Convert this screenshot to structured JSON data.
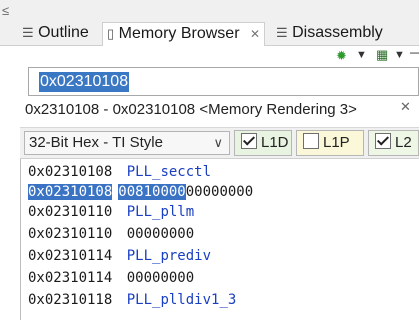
{
  "tabs": [
    {
      "label": "Outline",
      "icon": "outline-icon"
    },
    {
      "label": "Memory Browser",
      "icon": "memory-icon",
      "close": "✕"
    },
    {
      "label": "Disassembly",
      "icon": "disassembly-icon"
    }
  ],
  "address_input": {
    "value": "0x02310108"
  },
  "rendering": {
    "title": "0x2310108 - 0x02310108 <Memory Rendering 3>",
    "close": "✕",
    "format": "32-Bit Hex - TI Style",
    "caches": [
      {
        "label": "L1D",
        "checked": true
      },
      {
        "label": "L1P",
        "checked": false
      },
      {
        "label": "L2",
        "checked": true
      }
    ]
  },
  "rows": [
    {
      "address": "0x02310108",
      "text": "PLL_secctl",
      "kind": "label"
    },
    {
      "address": "0x02310108",
      "text": "00810000",
      "extra": "00000000",
      "kind": "value",
      "selected": true
    },
    {
      "address": "0x02310110",
      "text": "PLL_pllm",
      "kind": "label"
    },
    {
      "address": "0x02310110",
      "text": "00000000",
      "kind": "value"
    },
    {
      "address": "0x02310114",
      "text": "PLL_prediv",
      "kind": "label"
    },
    {
      "address": "0x02310114",
      "text": "00000000",
      "kind": "value"
    },
    {
      "address": "0x02310118",
      "text": "PLL_plldiv1_3",
      "kind": "label"
    }
  ],
  "colors": {
    "accent": "#3a73c4",
    "label_text": "#1a3fc0",
    "cache_l1d_bg": "#e9f3e2",
    "cache_l1p_bg": "#fbf8d9",
    "cache_l2_bg": "#eef7e6"
  }
}
